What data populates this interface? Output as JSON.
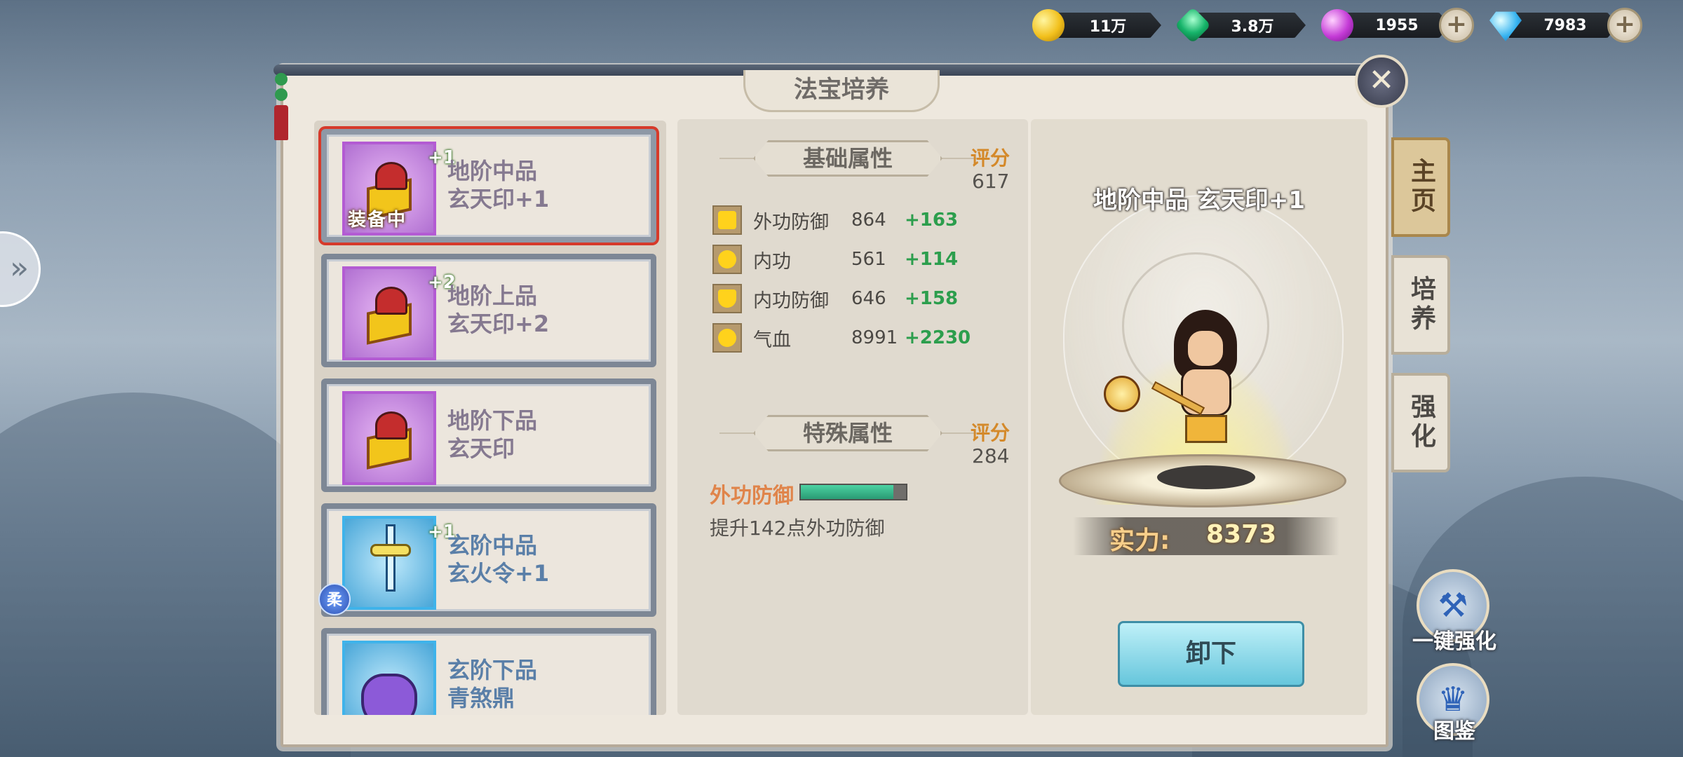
{
  "currency": {
    "gold": "11万",
    "jade": "3.8万",
    "orb": "1955",
    "diamond": "7983",
    "plus": "+"
  },
  "panel": {
    "title": "法宝培养",
    "close": "✕"
  },
  "items": [
    {
      "line1": "地阶中品",
      "line2": "玄天印+1",
      "plus": "+1",
      "tag": "装备中"
    },
    {
      "line1": "地阶上品",
      "line2": "玄天印+2",
      "plus": "+2"
    },
    {
      "line1": "地阶下品",
      "line2": "玄天印"
    },
    {
      "line1": "玄阶中品",
      "line2": "玄火令+1",
      "plus": "+1",
      "badge": "柔"
    },
    {
      "line1": "玄阶下品",
      "line2": "青煞鼎"
    }
  ],
  "basic": {
    "title": "基础属性",
    "score_label": "评分",
    "score": "617",
    "stats": [
      {
        "name": "外功防御",
        "value": "864",
        "add": "+163"
      },
      {
        "name": "内功",
        "value": "561",
        "add": "+114"
      },
      {
        "name": "内功防御",
        "value": "646",
        "add": "+158"
      },
      {
        "name": "气血",
        "value": "8991",
        "add": "+2230"
      }
    ]
  },
  "special": {
    "title": "特殊属性",
    "score_label": "评分",
    "score": "284",
    "attr_name": "外功防御",
    "progress": 0.88,
    "desc": "提升142点外功防御"
  },
  "preview": {
    "item_title": "地阶中品 玄天印+1",
    "power_label": "实力:",
    "power_value": "8373",
    "unequip": "卸下"
  },
  "tabs": [
    "主页",
    "培养",
    "强化"
  ],
  "side_buttons": {
    "oneclick": "一键强化",
    "codex": "图鉴"
  }
}
